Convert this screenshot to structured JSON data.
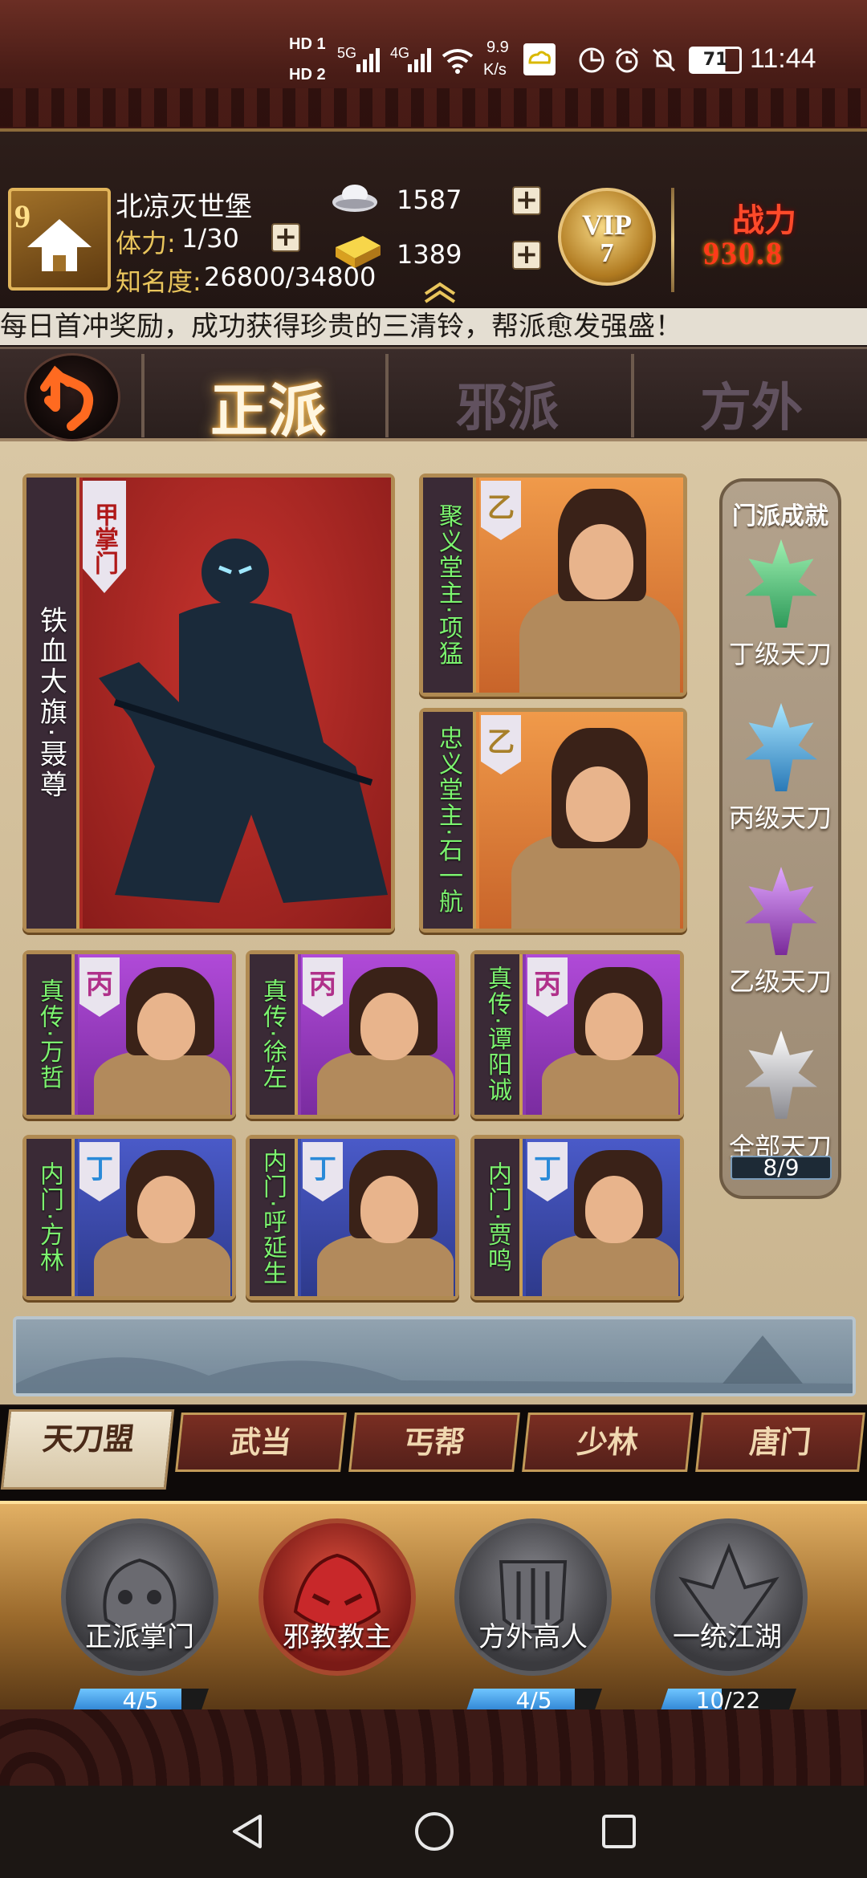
{
  "status_bar": {
    "hd1": "HD 1",
    "hd2": "HD 2",
    "net1": "5G",
    "net2": "4G",
    "speed_value": "9.9",
    "speed_unit": "K/s",
    "battery": "71",
    "time": "11:44"
  },
  "header": {
    "level": "9",
    "server_name": "北凉灭世堡",
    "stamina_label": "体力:",
    "stamina_value": "1/30",
    "fame_label": "知名度:",
    "fame_value": "26800/34800",
    "silver": "1587",
    "gold": "1389",
    "vip_label": "VIP",
    "vip_level": "7",
    "power_label": "战力",
    "power_value": "930.8"
  },
  "marquee": "每日首冲奖励，成功获得珍贵的三清铃，帮派愈发强盛！",
  "faction_tabs": {
    "active": "正派",
    "tab2": "邪派",
    "tab3": "方外"
  },
  "cards": {
    "leader": {
      "rank": "甲掌门",
      "name": "铁血大旗·聂尊"
    },
    "elder1": {
      "rank": "乙",
      "name": "聚义堂主·项猛"
    },
    "elder2": {
      "rank": "乙",
      "name": "忠义堂主·石一航"
    },
    "disciples": [
      {
        "rank": "丙",
        "name": "真传·万哲"
      },
      {
        "rank": "丙",
        "name": "真传·徐左"
      },
      {
        "rank": "丙",
        "name": "真传·谭阳诚"
      },
      {
        "rank": "丁",
        "name": "内门·方林"
      },
      {
        "rank": "丁",
        "name": "内门·呼延生"
      },
      {
        "rank": "丁",
        "name": "内门·贾鸣"
      }
    ]
  },
  "achievements": {
    "title": "门派成就",
    "items": [
      "丁级天刀",
      "丙级天刀",
      "乙级天刀",
      "全部天刀"
    ],
    "progress": "8/9",
    "colors": [
      "#4ec27a",
      "#4aa6d8",
      "#a04ab8",
      "#c8c8cc"
    ]
  },
  "sect_tabs": [
    "天刀盟",
    "武当",
    "丐帮",
    "少林",
    "唐门"
  ],
  "bottom_medals": [
    {
      "name": "正派掌门",
      "progress": "4/5",
      "fraction": 0.8
    },
    {
      "name": "邪教教主",
      "progress": "",
      "fraction": 0
    },
    {
      "name": "方外高人",
      "progress": "4/5",
      "fraction": 0.8
    },
    {
      "name": "一统江湖",
      "progress": "10/22",
      "fraction": 0.4545
    }
  ],
  "nav": {
    "back": "back-triangle",
    "home": "home-circle",
    "recent": "recent-square"
  }
}
